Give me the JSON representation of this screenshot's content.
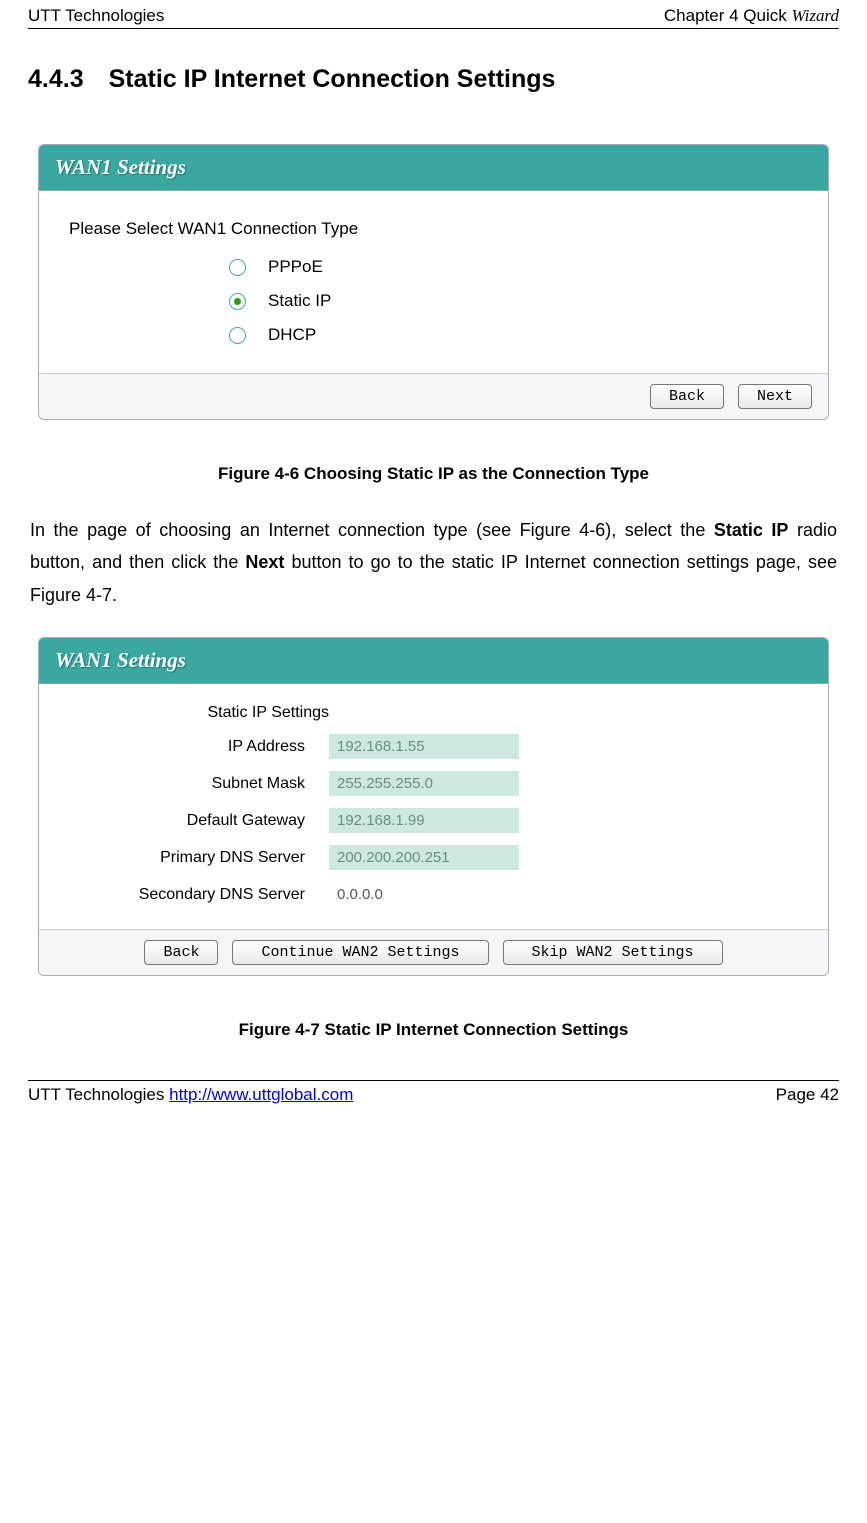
{
  "header": {
    "left": "UTT Technologies",
    "right_prefix": "Chapter 4 Quick ",
    "right_italic": "Wizard"
  },
  "section_heading": "4.4.3 Static IP Internet Connection Settings",
  "panel1": {
    "title": "WAN1 Settings",
    "prompt": "Please Select WAN1 Connection Type",
    "options": [
      {
        "label": "PPPoE",
        "checked": false
      },
      {
        "label": "Static IP",
        "checked": true
      },
      {
        "label": "DHCP",
        "checked": false
      }
    ],
    "buttons": {
      "back": "Back",
      "next": "Next"
    }
  },
  "caption1": "Figure 4-6 Choosing Static IP as the Connection Type",
  "paragraph": {
    "t1": "In the page of choosing an Internet connection type (see Figure 4-6), select the ",
    "b1": "Static IP",
    "t2": " radio button, and then click the ",
    "b2": "Next",
    "t3": " button to go to the static IP Internet connection settings page, see Figure 4-7."
  },
  "panel2": {
    "title": "WAN1 Settings",
    "form_heading": "Static IP Settings",
    "fields": {
      "ip": {
        "label": "IP Address",
        "value": "192.168.1.55"
      },
      "mask": {
        "label": "Subnet Mask",
        "value": "255.255.255.0"
      },
      "gw": {
        "label": "Default Gateway",
        "value": "192.168.1.99"
      },
      "dns1": {
        "label": "Primary DNS Server",
        "value": "200.200.200.251"
      },
      "dns2": {
        "label": "Secondary DNS Server",
        "value": "0.0.0.0"
      }
    },
    "buttons": {
      "back": "Back",
      "continue": "Continue WAN2 Settings",
      "skip": "Skip WAN2 Settings"
    }
  },
  "caption2": "Figure 4-7 Static IP Internet Connection Settings",
  "footer": {
    "left_prefix": "UTT Technologies ",
    "link": "http://www.uttglobal.com",
    "right": "Page 42"
  }
}
